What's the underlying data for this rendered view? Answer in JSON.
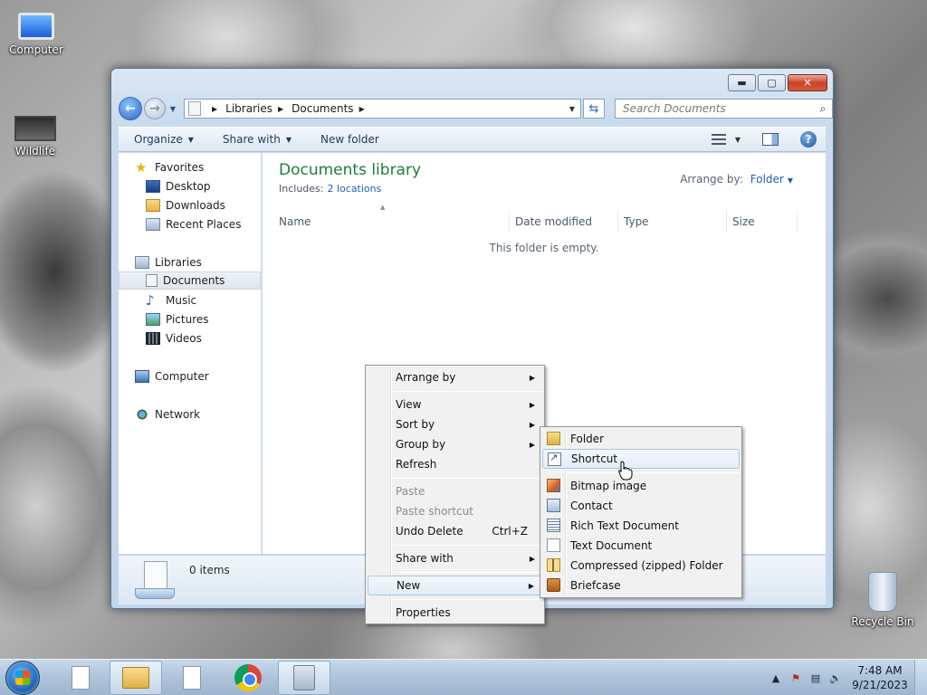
{
  "desktop": {
    "icons": [
      {
        "label": "Computer"
      },
      {
        "label": "Wildlife"
      },
      {
        "label": "Recycle Bin"
      }
    ]
  },
  "window": {
    "caption_buttons": {
      "minimize": "▬",
      "maximize": "▢",
      "close": "✕"
    },
    "address": {
      "crumbs": [
        "Libraries",
        "Documents"
      ]
    },
    "search": {
      "placeholder": "Search Documents"
    },
    "toolbar": {
      "organize": "Organize",
      "share_with": "Share with",
      "new_folder": "New folder"
    },
    "nav_pane": {
      "favorites": "Favorites",
      "desktop": "Desktop",
      "downloads": "Downloads",
      "recent_places": "Recent Places",
      "libraries": "Libraries",
      "documents": "Documents",
      "music": "Music",
      "pictures": "Pictures",
      "videos": "Videos",
      "computer": "Computer",
      "network": "Network"
    },
    "content": {
      "title": "Documents library",
      "includes_label": "Includes:",
      "includes_link": "2 locations",
      "arrange_label": "Arrange by:",
      "arrange_value": "Folder",
      "columns": [
        "Name",
        "Date modified",
        "Type",
        "Size"
      ],
      "empty_message": "This folder is empty."
    },
    "details": {
      "count": "0 items"
    }
  },
  "context_menu": {
    "arrange_by": "Arrange by",
    "view": "View",
    "sort_by": "Sort by",
    "group_by": "Group by",
    "refresh": "Refresh",
    "paste": "Paste",
    "paste_shortcut": "Paste shortcut",
    "undo_delete": "Undo Delete",
    "undo_shortcut": "Ctrl+Z",
    "share_with": "Share with",
    "new": "New",
    "properties": "Properties"
  },
  "new_submenu": {
    "folder": "Folder",
    "shortcut": "Shortcut",
    "bitmap": "Bitmap image",
    "contact": "Contact",
    "rtf": "Rich Text Document",
    "text": "Text Document",
    "zip": "Compressed (zipped) Folder",
    "briefcase": "Briefcase"
  },
  "taskbar": {
    "clock_time": "7:48 AM",
    "clock_date": "9/21/2023"
  }
}
